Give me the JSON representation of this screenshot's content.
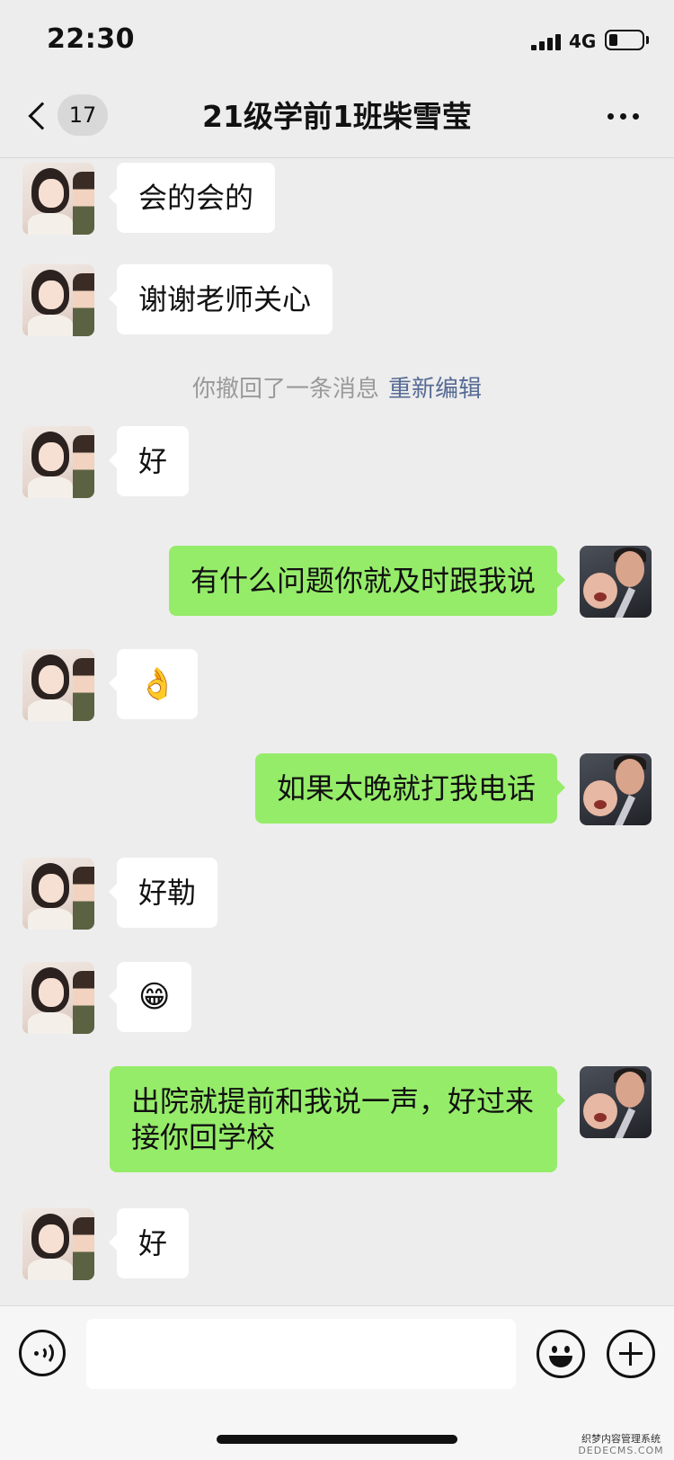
{
  "status_bar": {
    "time": "22:30",
    "network": "4G",
    "battery_icon": "battery-low-icon",
    "signal_icon": "cellular-signal-icon"
  },
  "nav": {
    "back_icon": "chevron-left-icon",
    "unread_count": "17",
    "title": "21级学前1班柴雪莹",
    "more_icon": "more-dots-icon"
  },
  "messages": [
    {
      "side": "in",
      "text": "会的会的"
    },
    {
      "side": "in",
      "text": "谢谢老师关心"
    },
    {
      "side": "system",
      "text": "你撤回了一条消息",
      "action": "重新编辑"
    },
    {
      "side": "in",
      "text": "好"
    },
    {
      "side": "out",
      "text": "有什么问题你就及时跟我说"
    },
    {
      "side": "in",
      "text": "👌",
      "emoji": true
    },
    {
      "side": "out",
      "text": "如果太晚就打我电话"
    },
    {
      "side": "in",
      "text": "好勒"
    },
    {
      "side": "in",
      "text": "😁",
      "emoji": true
    },
    {
      "side": "out",
      "text": "出院就提前和我说一声，好过来接你回学校"
    },
    {
      "side": "in",
      "text": "好"
    }
  ],
  "input_bar": {
    "voice_icon": "voice-input-icon",
    "input_value": "",
    "emoji_icon": "emoji-smile-icon",
    "plus_icon": "plus-circle-icon"
  },
  "watermark": {
    "line1": "织梦内容管理系统",
    "line2": "DEDECMS.COM"
  },
  "colors": {
    "background": "#ededed",
    "outgoing_bubble": "#95ec69",
    "incoming_bubble": "#ffffff",
    "link": "#576b95",
    "system_text": "#9a9a9a"
  }
}
